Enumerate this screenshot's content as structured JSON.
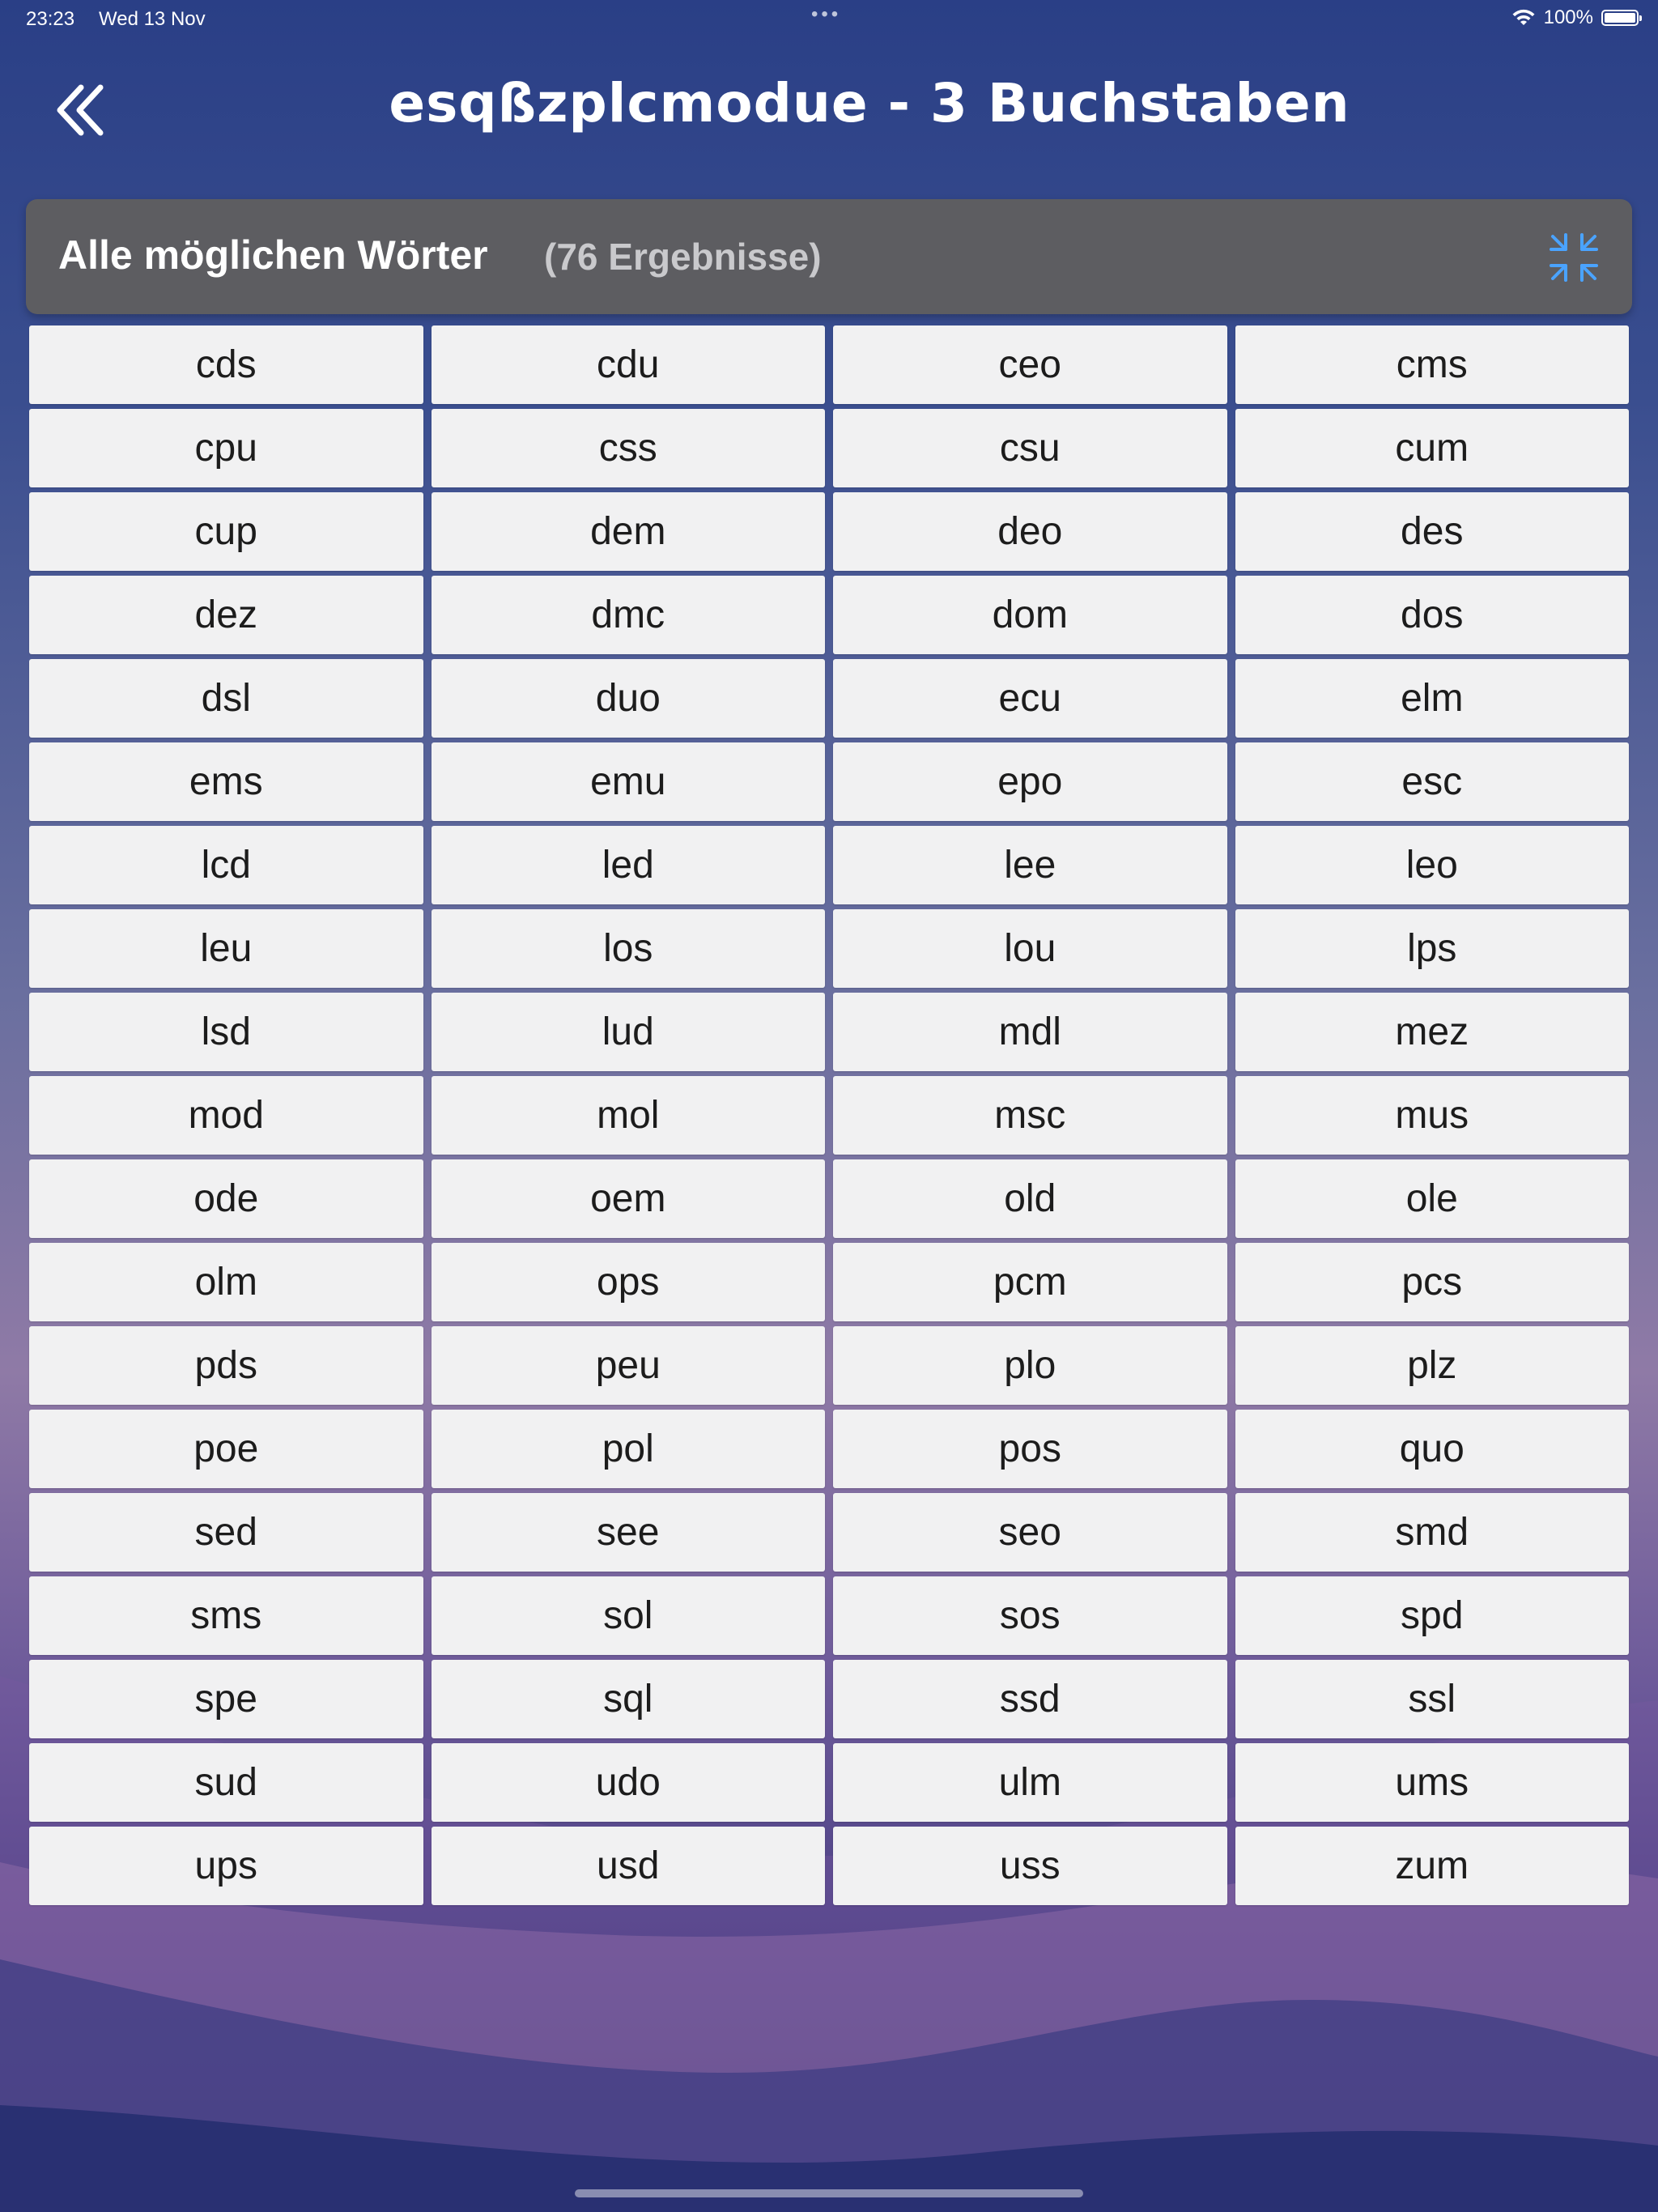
{
  "status_bar": {
    "time": "23:23",
    "date": "Wed 13 Nov",
    "dots": "•••",
    "battery_text": "100%",
    "battery_level": 1.0
  },
  "header": {
    "title": "esqßzplcmodue - 3 Buchstaben",
    "back_icon": "double-chevron-left-icon"
  },
  "results": {
    "title": "Alle möglichen Wörter",
    "count_text": "(76 Ergebnisse)",
    "collapse_icon": "collapse-arrows-icon",
    "accent_color": "#4aa3ff"
  },
  "words": [
    "cds",
    "cdu",
    "ceo",
    "cms",
    "cpu",
    "css",
    "csu",
    "cum",
    "cup",
    "dem",
    "deo",
    "des",
    "dez",
    "dmc",
    "dom",
    "dos",
    "dsl",
    "duo",
    "ecu",
    "elm",
    "ems",
    "emu",
    "epo",
    "esc",
    "lcd",
    "led",
    "lee",
    "leo",
    "leu",
    "los",
    "lou",
    "lps",
    "lsd",
    "lud",
    "mdl",
    "mez",
    "mod",
    "mol",
    "msc",
    "mus",
    "ode",
    "oem",
    "old",
    "ole",
    "olm",
    "ops",
    "pcm",
    "pcs",
    "pds",
    "peu",
    "plo",
    "plz",
    "poe",
    "pol",
    "pos",
    "quo",
    "sed",
    "see",
    "seo",
    "smd",
    "sms",
    "sol",
    "sos",
    "spd",
    "spe",
    "sql",
    "ssd",
    "ssl",
    "sud",
    "udo",
    "ulm",
    "ums",
    "ups",
    "usd",
    "uss",
    "zum"
  ]
}
